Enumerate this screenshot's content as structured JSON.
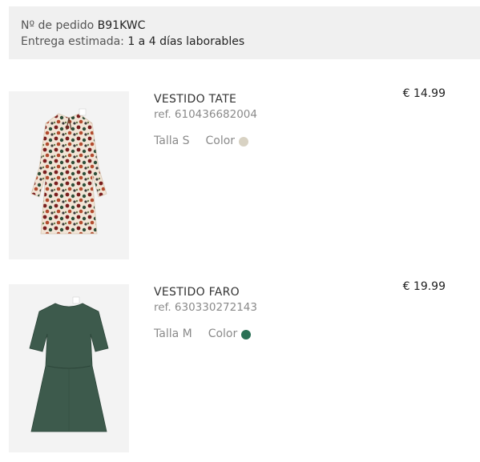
{
  "order": {
    "number_label": "Nº de pedido",
    "number_value": "B91KWC",
    "delivery_label": "Entrega estimada:",
    "delivery_value": "1 a 4 días laborables"
  },
  "products": [
    {
      "name": "VESTIDO TATE",
      "ref": "ref. 610436682004",
      "size": "Talla S",
      "color_label": "Color",
      "color": "#d8d2c3",
      "price": "€ 14.99"
    },
    {
      "name": "VESTIDO FARO",
      "ref": "ref. 630330272143",
      "size": "Talla M",
      "color_label": "Color",
      "color": "#2a7055",
      "price": "€ 19.99"
    }
  ]
}
